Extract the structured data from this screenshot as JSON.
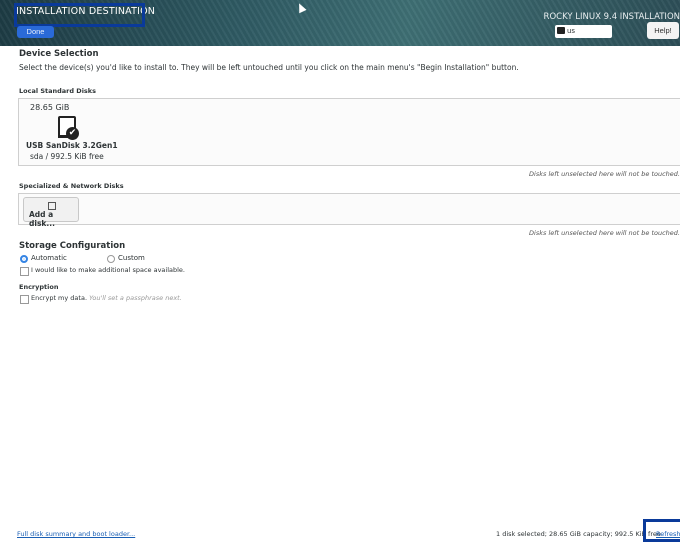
{
  "header": {
    "title": "INSTALLATION DESTINATION",
    "done_label": "Done",
    "distro": "ROCKY LINUX 9.4 INSTALLATION",
    "keyboard_layout": "us",
    "help_label": "Help!"
  },
  "device_selection": {
    "heading": "Device Selection",
    "description": "Select the device(s) you'd like to install to.  They will be left untouched until you click on the main menu's \"Begin Installation\" button.",
    "local_heading": "Local Standard Disks",
    "disk": {
      "size": "28.65 GiB",
      "name": "USB SanDisk 3.2Gen1",
      "info": "sda  /  992.5 KiB free",
      "selected": true
    },
    "untouched_note_1": "Disks left unselected here will not be touched.",
    "specialized_heading": "Specialized & Network Disks",
    "add_disk_label": "Add a disk...",
    "untouched_note_2": "Disks left unselected here will not be touched."
  },
  "storage": {
    "heading": "Storage Configuration",
    "automatic_label": "Automatic",
    "custom_label": "Custom",
    "selected_mode": "Automatic",
    "additional_space_label": "I would like to make additional space available.",
    "encryption_heading": "Encryption",
    "encrypt_label": "Encrypt my data.",
    "encrypt_hint": "You'll set a passphrase next."
  },
  "footer": {
    "summary_link": "Full disk summary and boot loader...",
    "status": "1 disk selected; 28.65 GiB capacity; 992.5 KiB free",
    "refresh_label": "Refresh..."
  },
  "colors": {
    "accent": "#3584e4",
    "done_button": "#2a6ad8",
    "highlight_box": "#0a3a9a",
    "link": "#1a5fb4"
  }
}
